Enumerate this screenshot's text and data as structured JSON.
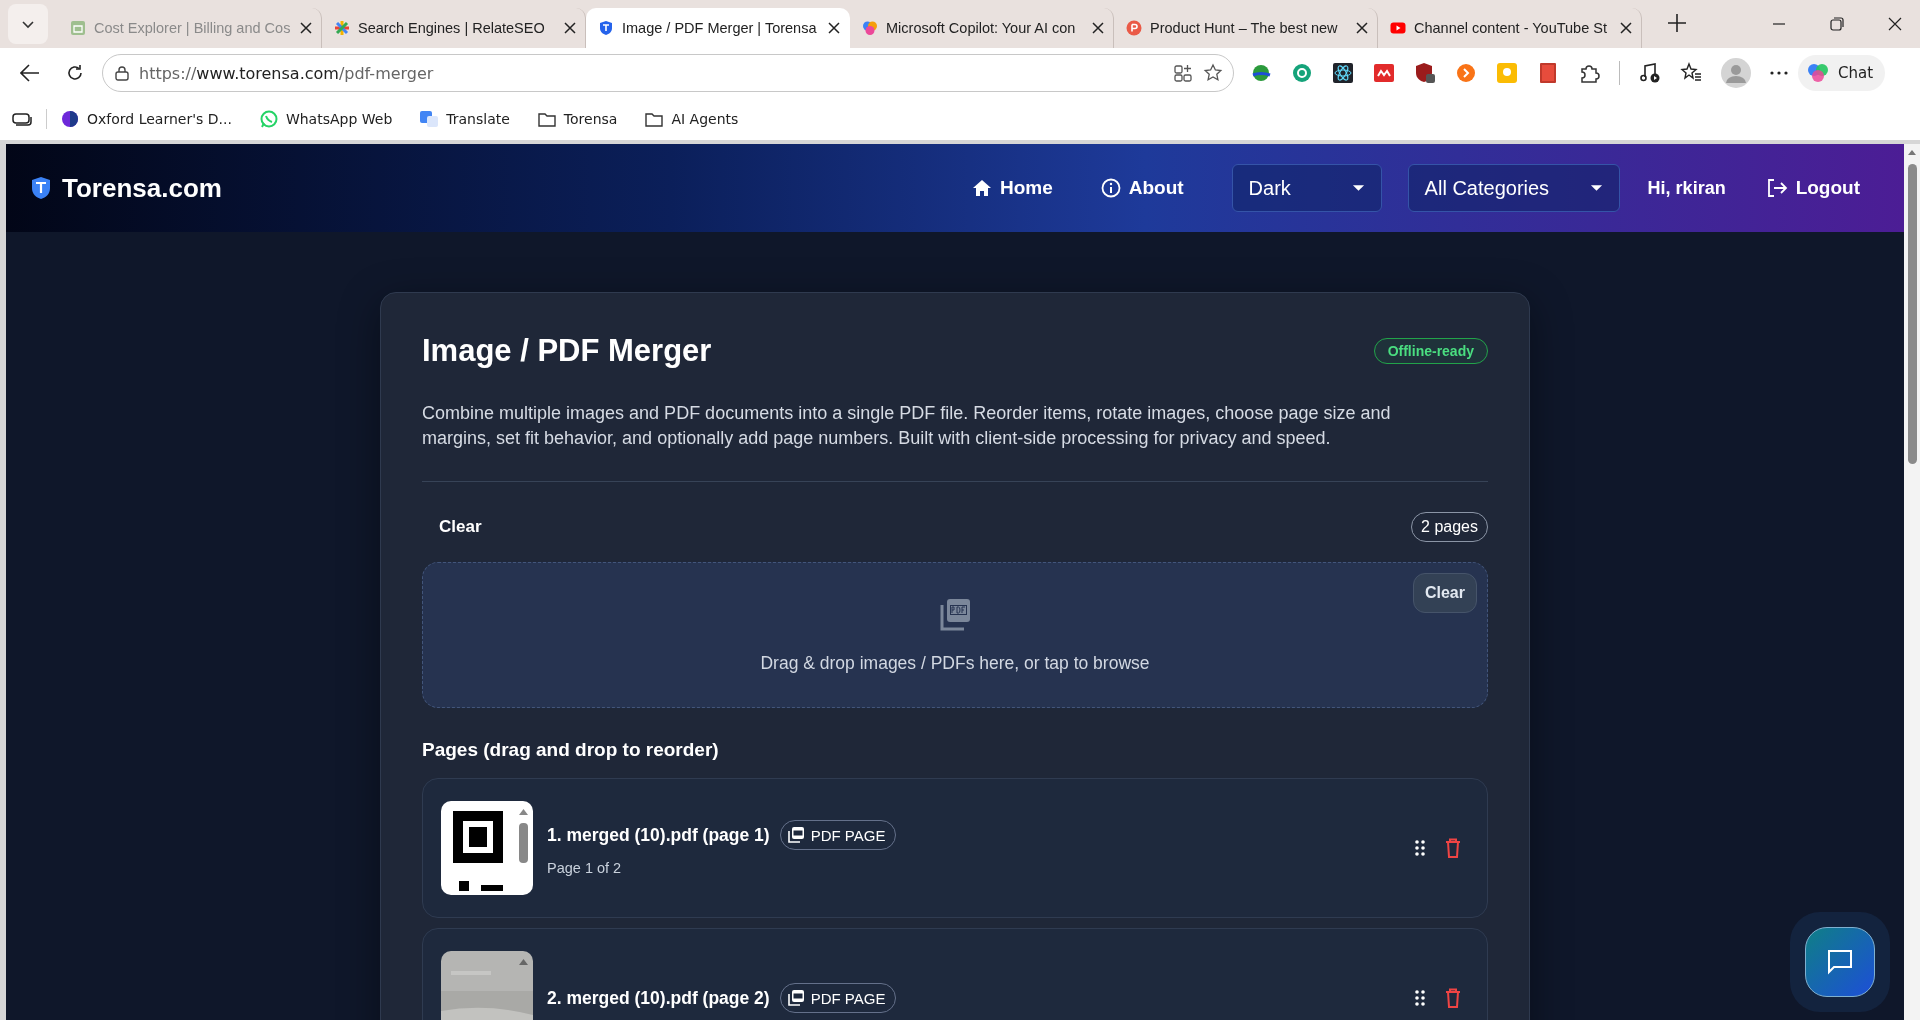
{
  "browser": {
    "tabs": [
      {
        "title": "Cost Explorer | Billing and Cos",
        "selected": false,
        "sleeping": true
      },
      {
        "title": "Search Engines | RelateSEO",
        "selected": false,
        "sleeping": false
      },
      {
        "title": "Image / PDF Merger | Torensa",
        "selected": true,
        "sleeping": false
      },
      {
        "title": "Microsoft Copilot: Your AI con",
        "selected": false,
        "sleeping": false
      },
      {
        "title": "Product Hunt – The best new",
        "selected": false,
        "sleeping": false
      },
      {
        "title": "Channel content - YouTube St",
        "selected": false,
        "sleeping": false
      }
    ],
    "address": {
      "scheme": "https://",
      "host": "www.torensa.com",
      "path": "/pdf-merger"
    },
    "chat_button": "Chat",
    "bookmarks": [
      "Oxford Learner's D...",
      "WhatsApp Web",
      "Translate",
      "Torensa",
      "AI Agents"
    ]
  },
  "header": {
    "brand": "Torensa.com",
    "nav": [
      "Home",
      "About"
    ],
    "theme_select": "Dark",
    "category_select": "All Categories",
    "greeting": "Hi, rkiran",
    "logout": "Logout"
  },
  "tool": {
    "title": "Image / PDF Merger",
    "badge": "Offline-ready",
    "description": "Combine multiple images and PDF documents into a single PDF file. Reorder items, rotate images, choose page size and margins, set fit behavior, and optionally add page numbers. Built with client-side processing for privacy and speed.",
    "clear_button": "Clear",
    "page_count": "2 pages",
    "dropzone": {
      "text": "Drag & drop images / PDFs here, or tap to browse",
      "clear_button": "Clear"
    },
    "pages_heading": "Pages (drag and drop to reorder)",
    "pages": [
      {
        "title": "1. merged (10).pdf (page 1)",
        "tag": "PDF PAGE",
        "subtitle": "Page 1 of 2"
      },
      {
        "title": "2. merged (10).pdf (page 2)",
        "tag": "PDF PAGE"
      }
    ]
  }
}
